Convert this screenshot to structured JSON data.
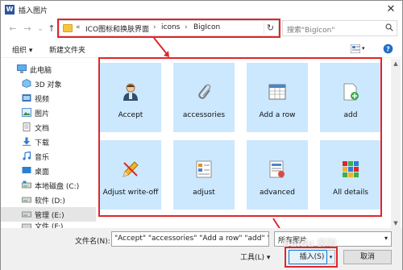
{
  "window": {
    "title": "插入图片",
    "app_icon_letter": "W"
  },
  "nav": {
    "back": "←",
    "forward": "→",
    "dropdown": "⌄",
    "up": "↑"
  },
  "address": {
    "prefix": "«",
    "crumbs": [
      "ICO图标和换肤界面",
      "icons",
      "BigIcon"
    ],
    "separator": "›",
    "refresh": "↻"
  },
  "search": {
    "placeholder": "搜索\"BigIcon\""
  },
  "toolbar": {
    "organize": "组织 ▾",
    "new_folder": "新建文件夹"
  },
  "sidebar": {
    "items": [
      {
        "label": "此电脑",
        "icon": "computer-icon"
      },
      {
        "label": "3D 对象",
        "icon": "cube-icon"
      },
      {
        "label": "视频",
        "icon": "video-icon"
      },
      {
        "label": "图片",
        "icon": "picture-icon"
      },
      {
        "label": "文档",
        "icon": "document-icon"
      },
      {
        "label": "下载",
        "icon": "download-icon"
      },
      {
        "label": "音乐",
        "icon": "music-icon"
      },
      {
        "label": "桌面",
        "icon": "desktop-icon"
      },
      {
        "label": "本地磁盘 (C:)",
        "icon": "drive-icon"
      },
      {
        "label": "软件 (D:)",
        "icon": "drive-icon"
      },
      {
        "label": "管理 (E:)",
        "icon": "drive-icon"
      },
      {
        "label": "文件 (F:)",
        "icon": "drive-icon"
      }
    ],
    "selected_index": 10
  },
  "files": [
    {
      "label": "Accept",
      "icon": "person-icon"
    },
    {
      "label": "accessories",
      "icon": "paperclip-icon"
    },
    {
      "label": "Add a row",
      "icon": "table-row-icon"
    },
    {
      "label": "add",
      "icon": "add-document-icon"
    },
    {
      "label": "Adjust write-off",
      "icon": "pencil-icon"
    },
    {
      "label": "adjust",
      "icon": "adjust-icon"
    },
    {
      "label": "advanced",
      "icon": "advanced-icon"
    },
    {
      "label": "All details",
      "icon": "grid-icon"
    }
  ],
  "footer": {
    "filename_label": "文件名(N):",
    "filename_value": "\"Accept\" \"accessories\" \"Add a row\" \"add\" \"Adj",
    "filetype_value": "所有图片",
    "tools_label": "工具(L) ▾",
    "insert_label": "插入(S)",
    "insert_dropdown": "▾",
    "cancel_label": "取消"
  },
  "watermark": "Baidu 经验",
  "colors": {
    "highlight": "#e0262a",
    "selection": "#cce8ff",
    "accent": "#0078d7"
  }
}
